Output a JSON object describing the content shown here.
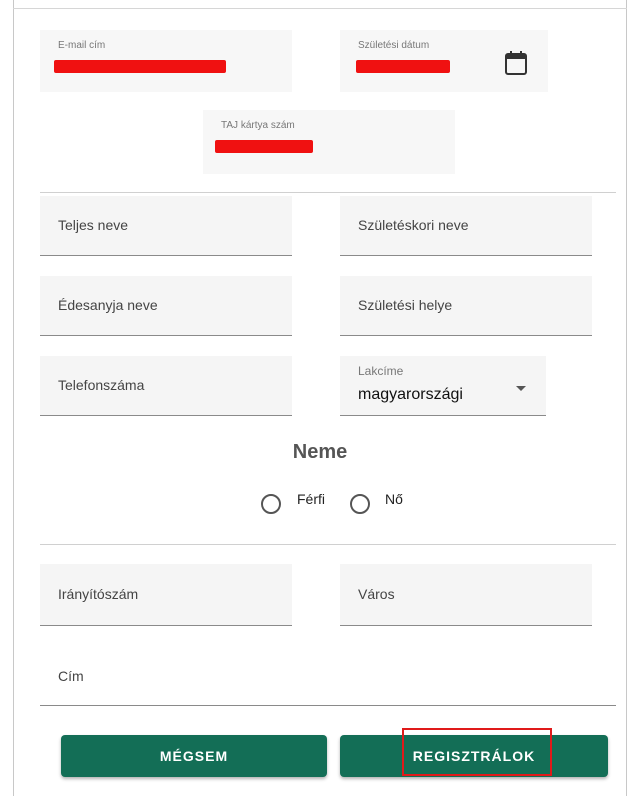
{
  "top_fields": {
    "email_label": "E-mail cím",
    "birthdate_label": "Születési dátum",
    "taj_label": "TAJ kártya szám"
  },
  "fields": {
    "full_name": "Teljes neve",
    "birth_name": "Születéskori neve",
    "mother_name": "Édesanyja neve",
    "birth_place": "Születési helye",
    "phone": "Telefonszáma",
    "address_type_label": "Lakcíme",
    "address_type_value": "magyarországi",
    "zip": "Irányítószám",
    "city": "Város",
    "address": "Cím"
  },
  "gender": {
    "title": "Neme",
    "options": [
      "Férfi",
      "Nő"
    ]
  },
  "buttons": {
    "cancel": "MÉGSEM",
    "register": "REGISZTRÁLOK"
  },
  "colors": {
    "button": "#136e56",
    "highlight": "#e01a1a",
    "redaction": "#f01111"
  }
}
